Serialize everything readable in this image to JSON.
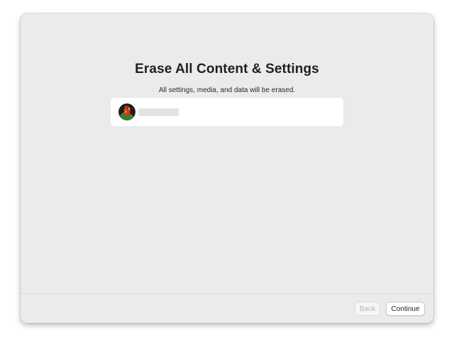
{
  "dialog": {
    "title": "Erase All Content & Settings",
    "subtitle": "All settings, media, and data will be erased."
  },
  "account": {
    "avatar_icon": "parrot-avatar-icon",
    "name": ""
  },
  "footer": {
    "back_label": "Back",
    "back_enabled": false,
    "continue_label": "Continue"
  },
  "colors": {
    "window_background": "#ebebeb",
    "card_background": "#ffffff",
    "disabled_text": "#b4b4b4"
  }
}
